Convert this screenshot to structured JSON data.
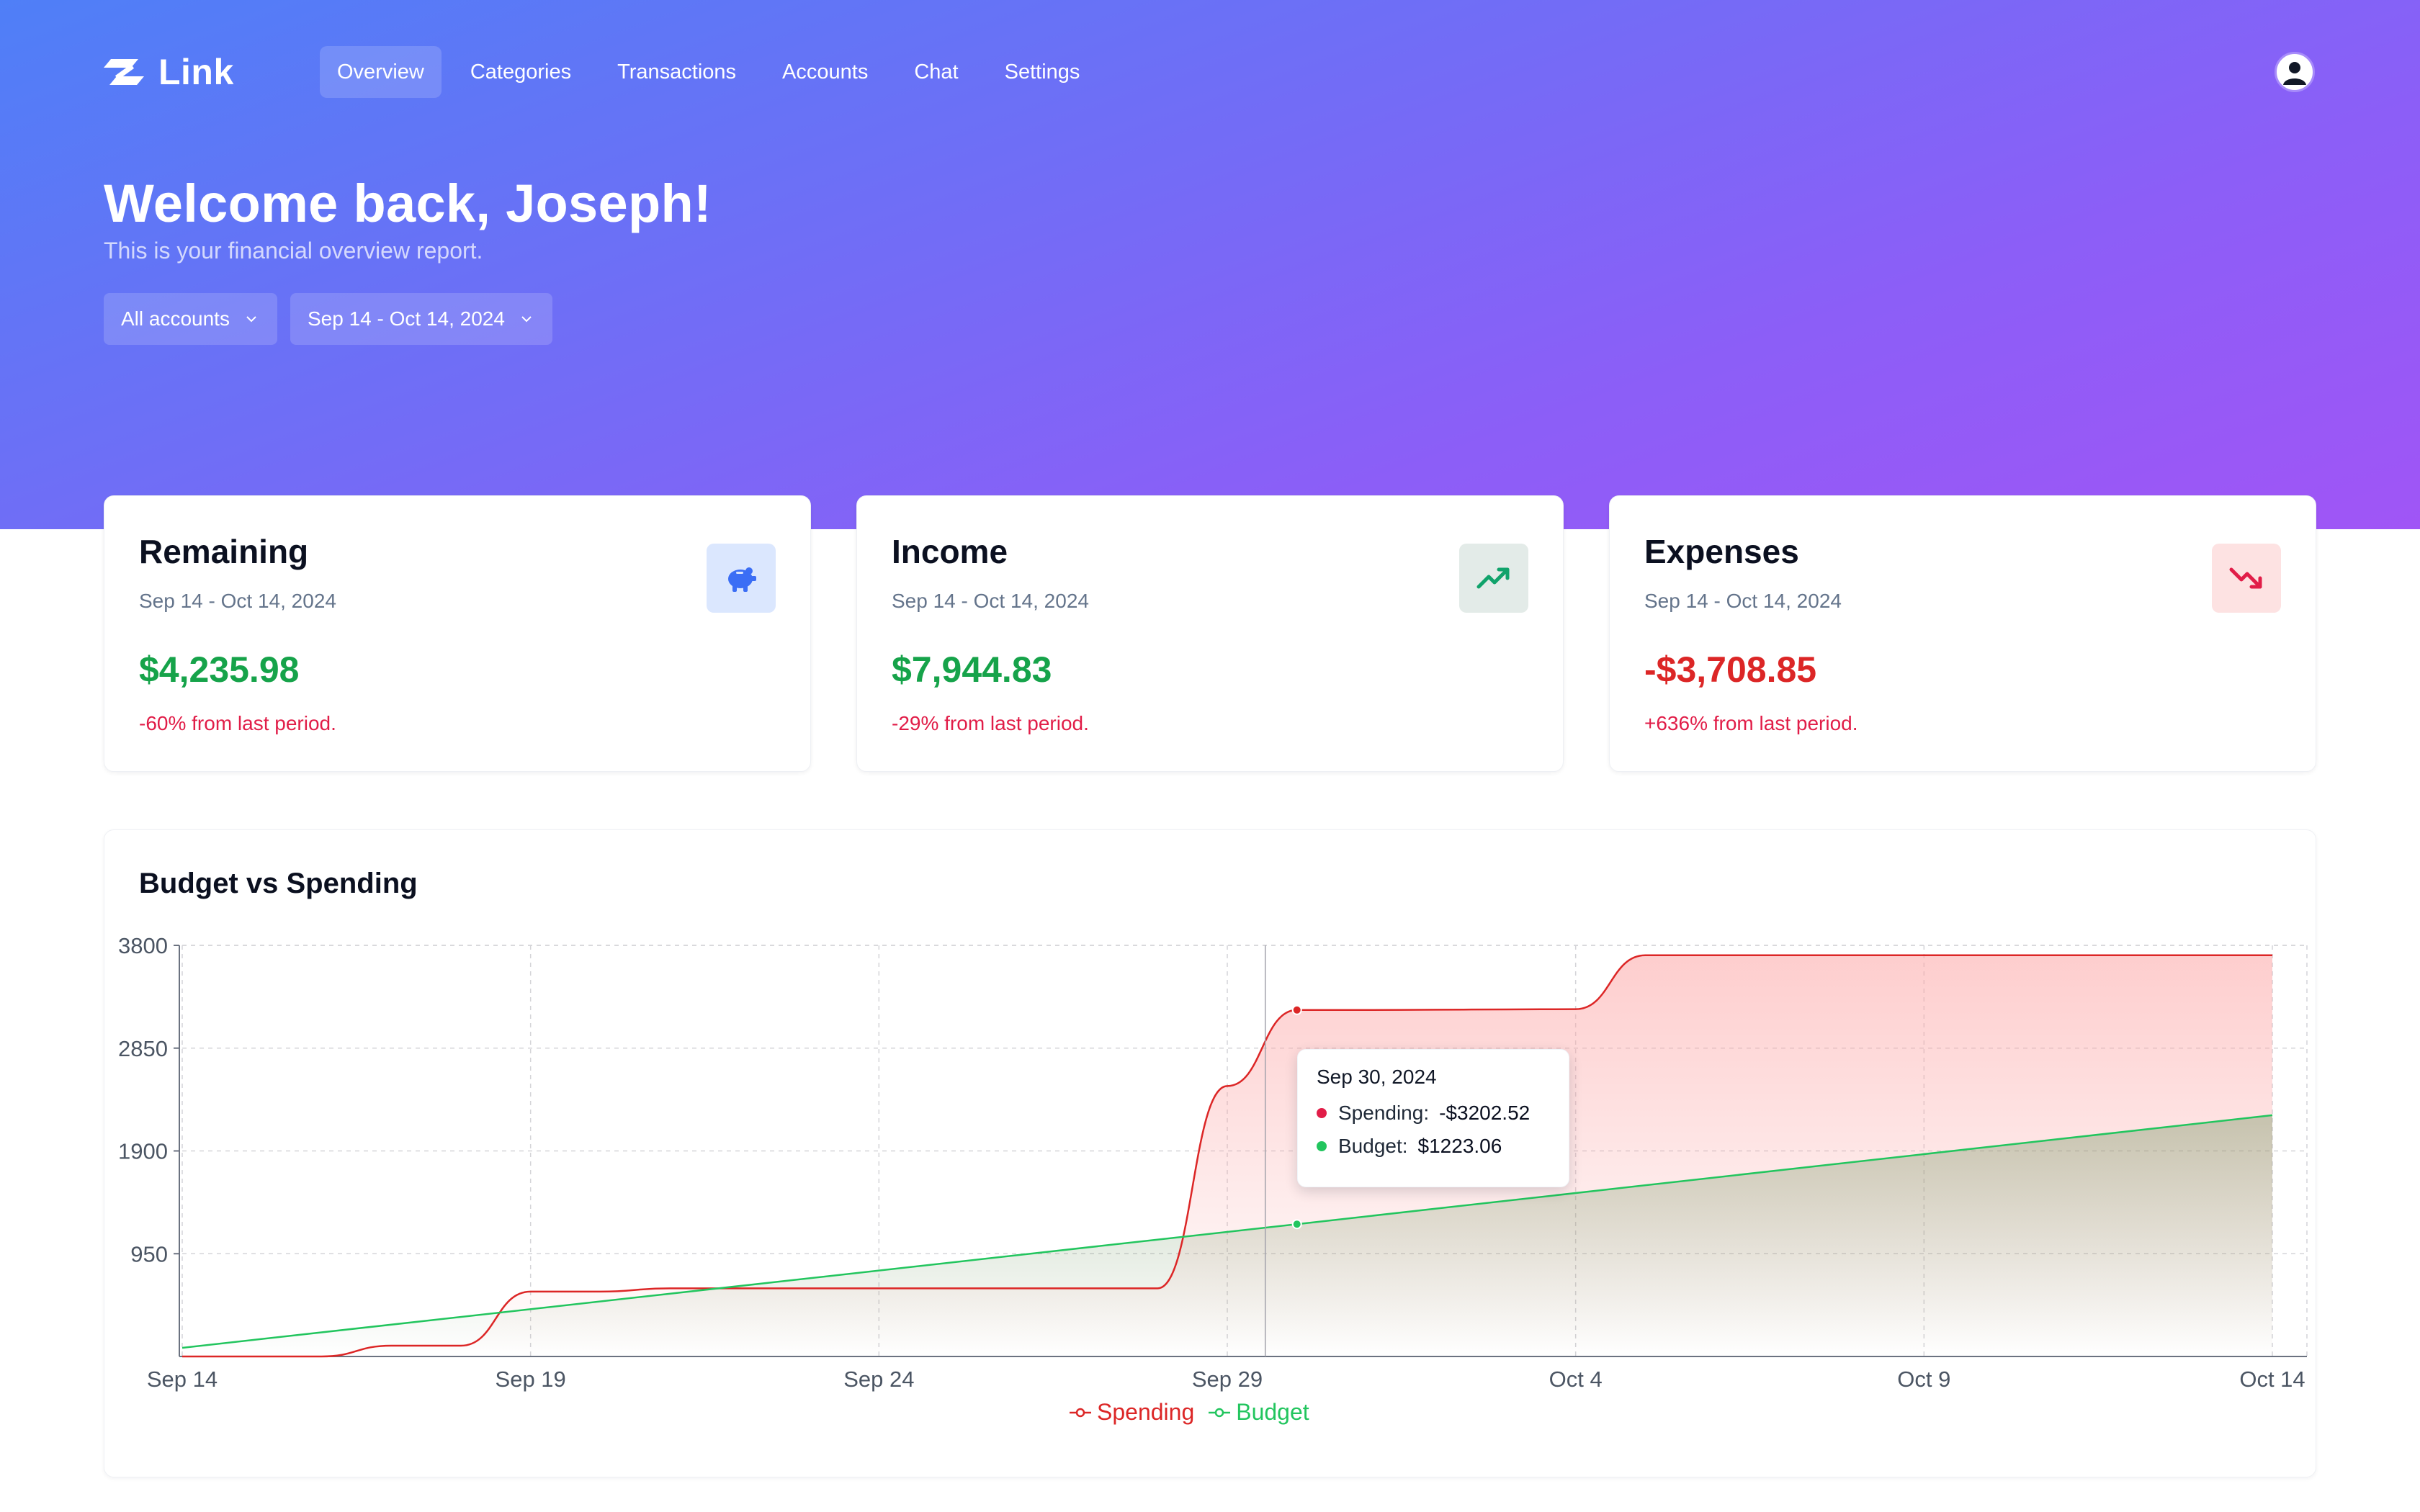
{
  "app": {
    "name": "Link"
  },
  "nav": {
    "items": [
      {
        "label": "Overview",
        "active": true
      },
      {
        "label": "Categories"
      },
      {
        "label": "Transactions"
      },
      {
        "label": "Accounts"
      },
      {
        "label": "Chat"
      },
      {
        "label": "Settings"
      }
    ]
  },
  "hero": {
    "welcome": "Welcome back, Joseph!",
    "subtitle": "This is your financial overview report.",
    "account_filter": "All accounts",
    "date_filter": "Sep 14 - Oct 14, 2024"
  },
  "cards": [
    {
      "title": "Remaining",
      "date": "Sep 14 - Oct 14, 2024",
      "value": "$4,235.98",
      "change": "-60% from last period.",
      "value_color": "#16a34a",
      "icon": "piggy-bank-icon"
    },
    {
      "title": "Income",
      "date": "Sep 14 - Oct 14, 2024",
      "value": "$7,944.83",
      "change": "-29% from last period.",
      "value_color": "#16a34a",
      "icon": "trending-up-icon"
    },
    {
      "title": "Expenses",
      "date": "Sep 14 - Oct 14, 2024",
      "value": "-$3,708.85",
      "change": "+636% from last period.",
      "value_color": "#dc2626",
      "icon": "trending-down-icon"
    }
  ],
  "chart": {
    "title": "Budget vs Spending",
    "tooltip": {
      "date": "Sep 30, 2024",
      "spending_label": "Spending:",
      "spending_value": "-$3202.52",
      "budget_label": "Budget:",
      "budget_value": "$1223.06"
    }
  },
  "chart_data": {
    "type": "area",
    "title": "Budget vs Spending",
    "x_ticks": [
      "Sep 14",
      "Sep 19",
      "Sep 24",
      "Sep 29",
      "Oct 4",
      "Oct 9",
      "Oct 14"
    ],
    "y_ticks": [
      950,
      1900,
      2850,
      3800
    ],
    "ylim": [
      0,
      3800
    ],
    "grid": true,
    "legend_position": "bottom-center",
    "series": [
      {
        "name": "Spending",
        "color": "#dc2626",
        "points": [
          [
            "Sep 14",
            0
          ],
          [
            "Sep 15",
            0
          ],
          [
            "Sep 16",
            0
          ],
          [
            "Sep 17",
            100
          ],
          [
            "Sep 18",
            100
          ],
          [
            "Sep 19",
            600
          ],
          [
            "Sep 20",
            600
          ],
          [
            "Sep 21",
            630
          ],
          [
            "Sep 22",
            630
          ],
          [
            "Sep 23",
            630
          ],
          [
            "Sep 24",
            630
          ],
          [
            "Sep 25",
            630
          ],
          [
            "Sep 26",
            630
          ],
          [
            "Sep 27",
            630
          ],
          [
            "Sep 28",
            630
          ],
          [
            "Sep 29",
            2500
          ],
          [
            "Sep 30",
            3202.52
          ],
          [
            "Oct 1",
            3202.52
          ],
          [
            "Oct 2",
            3205
          ],
          [
            "Oct 3",
            3208
          ],
          [
            "Oct 4",
            3210
          ],
          [
            "Oct 5",
            3708.85
          ],
          [
            "Oct 6",
            3708.85
          ],
          [
            "Oct 7",
            3708.85
          ],
          [
            "Oct 8",
            3708.85
          ],
          [
            "Oct 9",
            3708.85
          ],
          [
            "Oct 10",
            3708.85
          ],
          [
            "Oct 11",
            3708.85
          ],
          [
            "Oct 12",
            3708.85
          ],
          [
            "Oct 13",
            3708.85
          ],
          [
            "Oct 14",
            3708.85
          ]
        ]
      },
      {
        "name": "Budget",
        "color": "#22c55e",
        "points": [
          [
            "Sep 14",
            80
          ],
          [
            "Sep 30",
            1223.06
          ],
          [
            "Oct 14",
            2230
          ]
        ]
      }
    ],
    "highlight": {
      "x": "Sep 30",
      "spending": -3202.52,
      "budget": 1223.06
    }
  }
}
